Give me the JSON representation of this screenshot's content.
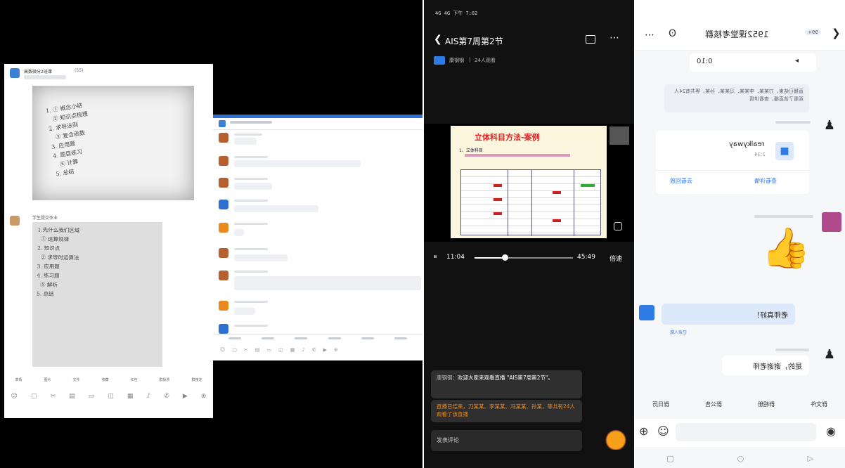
{
  "panel1": {
    "sender1": "高数微分2班课",
    "sender1_sub": "(55)",
    "sender2": "学生提交作业",
    "handwriting1": "1. ① 概念小结\n   ② 知识点梳理\n2. 求导法则\n   ③ 复合函数\n3. 应用题\n4. 题目练习\n   ⑤ 计算\n5. 总结",
    "handwriting2": "1.先什么我们区域\n  ① 运算规律\n2. 知识点\n  ② 求导时运算法\n3. 应用题\n4. 练习题\n  ⑤ 解析\n5. 总结",
    "menu": [
      "表情",
      "图片",
      "文件",
      "收藏",
      "红包",
      "群投票",
      "群接龙"
    ]
  },
  "panel2": {
    "messages": [
      "",
      "",
      "",
      "",
      "",
      "",
      "",
      ""
    ]
  },
  "panel3": {
    "status": "4G 4G 下午 7:02",
    "title": "AIS第7周第2节",
    "host": "康钢钢",
    "viewers": "24人观看",
    "slide_title": "立体科目方法-案例",
    "slide_item": "1、立体科目",
    "time_current": "11:04",
    "time_total": "45:49",
    "speed": "倍速",
    "progress": 0.31,
    "chat1_name": "康钢钢：",
    "chat1_text": "欢迎大家来观看直播 \"AIS第7周第2节\"。",
    "chat2_text": "直播已结束，刀某某、李某某、冯某某、孙某，等共有24人观看了该直播",
    "comment_placeholder": "发表评论"
  },
  "panel4": {
    "title": "1952课堂考核群",
    "badge": "99+",
    "voice_time": "0:10",
    "notice": "直播已结束，刀某某、李某某、冯某某、孙某，等共有24人观看了该直播，查看详情",
    "card_name": "realkyway",
    "card_sub": "2:34",
    "card_btn1": "去看回放",
    "card_btn2": "查看详情",
    "reply_text": "老师真好！",
    "reply_sub": "已读人数",
    "reply2_text": "是的，谢谢老师",
    "tabs": [
      "群文件",
      "群相册",
      "群公告",
      "群日历"
    ]
  }
}
